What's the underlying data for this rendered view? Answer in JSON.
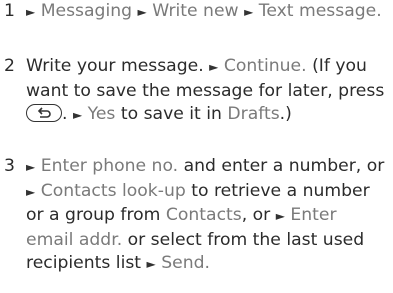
{
  "arrow": "►",
  "steps": [
    {
      "num": "1",
      "menu_messaging": "Messaging",
      "menu_write_new": "Write new",
      "menu_text_message": "Text message",
      "period": "."
    },
    {
      "num": "2",
      "text_a": "Write your message.",
      "continue": "Continue.",
      "text_b": "(If you want to save the message for later, press",
      "back_key_icon": "back-arrow-key",
      "yes": "Yes",
      "text_c": "to save it in",
      "drafts": "Drafts",
      "text_d": ".)"
    },
    {
      "num": "3",
      "enter_phone": "Enter phone no.",
      "text_a": "and enter a number, or",
      "contacts_lookup": "Contacts look-up",
      "text_b": "to retrieve a number or a group from",
      "contacts": "Contacts",
      "text_c": ", or",
      "enter_email": "Enter email addr.",
      "text_d": "or select from the last used recipients list",
      "send": "Send",
      "period": "."
    }
  ]
}
